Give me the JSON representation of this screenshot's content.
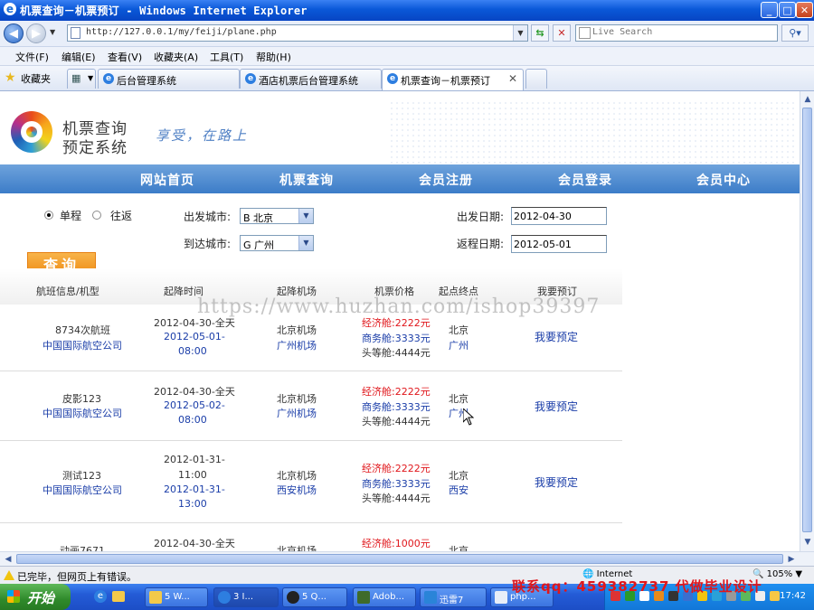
{
  "window": {
    "title": "机票查询－机票预订 - Windows Internet Explorer"
  },
  "browser": {
    "address": "http://127.0.0.1/my/feiji/plane.php",
    "search_placeholder": "Live Search",
    "menu": [
      "文件(F)",
      "编辑(E)",
      "查看(V)",
      "收藏夹(A)",
      "工具(T)",
      "帮助(H)"
    ],
    "favorites_label": "收藏夹",
    "tabs": [
      {
        "label": "后台管理系统"
      },
      {
        "label": "酒店机票后台管理系统"
      },
      {
        "label": "机票查询－机票预订",
        "active": true
      }
    ]
  },
  "site": {
    "logo_line1": "机票查询",
    "logo_line2": "预定系统",
    "slogan": "享受，在路上",
    "nav": [
      "网站首页",
      "机票查询",
      "会员注册",
      "会员登录",
      "会员中心"
    ]
  },
  "search_form": {
    "trip_types": [
      {
        "label": "单程",
        "selected": true
      },
      {
        "label": "往返",
        "selected": false
      }
    ],
    "from_label": "出发城市:",
    "from_value": "B 北京",
    "to_label": "到达城市:",
    "to_value": "G 广州",
    "depart_label": "出发日期:",
    "depart_value": "2012-04-30",
    "return_label": "返程日期:",
    "return_value": "2012-05-01",
    "query_button": "查询"
  },
  "results": {
    "headers": [
      "航班信息/机型",
      "起降时间",
      "起降机场",
      "机票价格",
      "起点终点",
      "我要预订"
    ],
    "rows": [
      {
        "flight": "8734次航班",
        "airline": "中国国际航空公司",
        "depart_time": "2012-04-30-全天",
        "arrive_time": [
          "2012-05-01-",
          "08:00"
        ],
        "depart_airport": "北京机场",
        "arrive_airport": "广州机场",
        "prices": [
          "经济舱:2222元",
          "商务舱:3333元",
          "头等舱:4444元"
        ],
        "origin": "北京",
        "destination": "广州",
        "book": "我要预定"
      },
      {
        "flight": "皮影123",
        "airline": "中国国际航空公司",
        "depart_time": "2012-04-30-全天",
        "arrive_time": [
          "2012-05-02-",
          "08:00"
        ],
        "depart_airport": "北京机场",
        "arrive_airport": "广州机场",
        "prices": [
          "经济舱:2222元",
          "商务舱:3333元",
          "头等舱:4444元"
        ],
        "origin": "北京",
        "destination": "广州",
        "book": "我要预定"
      },
      {
        "flight": "测试123",
        "airline": "中国国际航空公司",
        "depart_time": [
          "2012-01-31-",
          "11:00"
        ],
        "arrive_time": [
          "2012-01-31-",
          "13:00"
        ],
        "depart_airport": "北京机场",
        "arrive_airport": "西安机场",
        "prices": [
          "经济舱:2222元",
          "商务舱:3333元",
          "头等舱:4444元"
        ],
        "origin": "北京",
        "destination": "西安",
        "book": "我要预定"
      },
      {
        "flight": "动画7671",
        "depart_time": "2012-04-30-全天",
        "depart_airport": "北京机场",
        "price_first": "经济舱:1000元",
        "origin": "北京"
      }
    ]
  },
  "overlay": {
    "watermark": "https://www.huzhan.com/ishop39397",
    "contact": "联系qq：459382737 代做毕业设计"
  },
  "statusbar": {
    "text": "已完毕，但网页上有错误。",
    "zone": "Internet",
    "zoom": "105%"
  },
  "taskbar": {
    "start": "开始",
    "items": [
      "5 W...",
      "3 I...",
      "5 Q...",
      "Adob...",
      "迅雷7",
      "php..."
    ],
    "clock": "17:42"
  },
  "colors": {
    "nav_bar": "#4c8ad2",
    "query_button": "#f09a1e",
    "price_economy": "#e0161b",
    "link_blue": "#1a3da8"
  }
}
